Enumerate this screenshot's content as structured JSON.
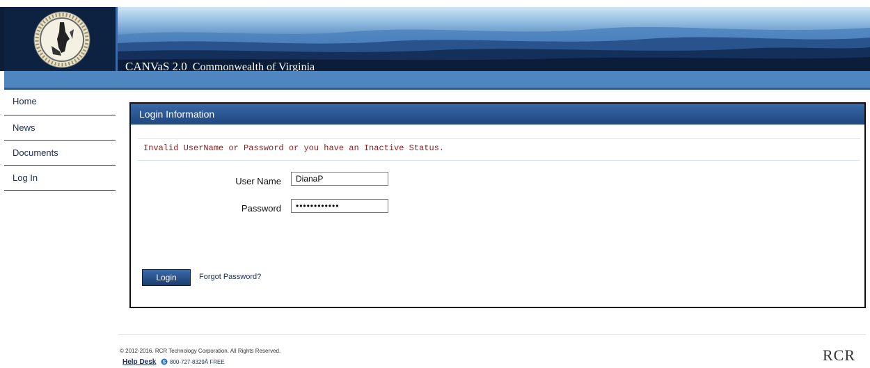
{
  "header": {
    "app_name": "CANVaS 2.0",
    "org": "Commonwealth of Virginia"
  },
  "sidebar": {
    "items": [
      {
        "label": "Home"
      },
      {
        "label": "News"
      },
      {
        "label": "Documents"
      },
      {
        "label": "Log In"
      }
    ]
  },
  "login": {
    "title": "Login Information",
    "error": "Invalid UserName or Password or you have an Inactive Status.",
    "username_label": "User Name",
    "username_value": "DianaP",
    "password_label": "Password",
    "password_value": "••••••••••••",
    "login_button": "Login",
    "forgot_link": "Forgot Password?"
  },
  "footer": {
    "copyright": "© 2012-2016. RCR Technology Corporation. All Rights Reserved.",
    "help_desk": "Help Desk",
    "phone": "800-727-8329Â FREE",
    "logo_text": "RCR"
  },
  "colors": {
    "header_dark": "#0b1d38",
    "bar_blue": "#4f86bf",
    "panel_head": "#1f4680",
    "error_text": "#8b1a1a"
  }
}
